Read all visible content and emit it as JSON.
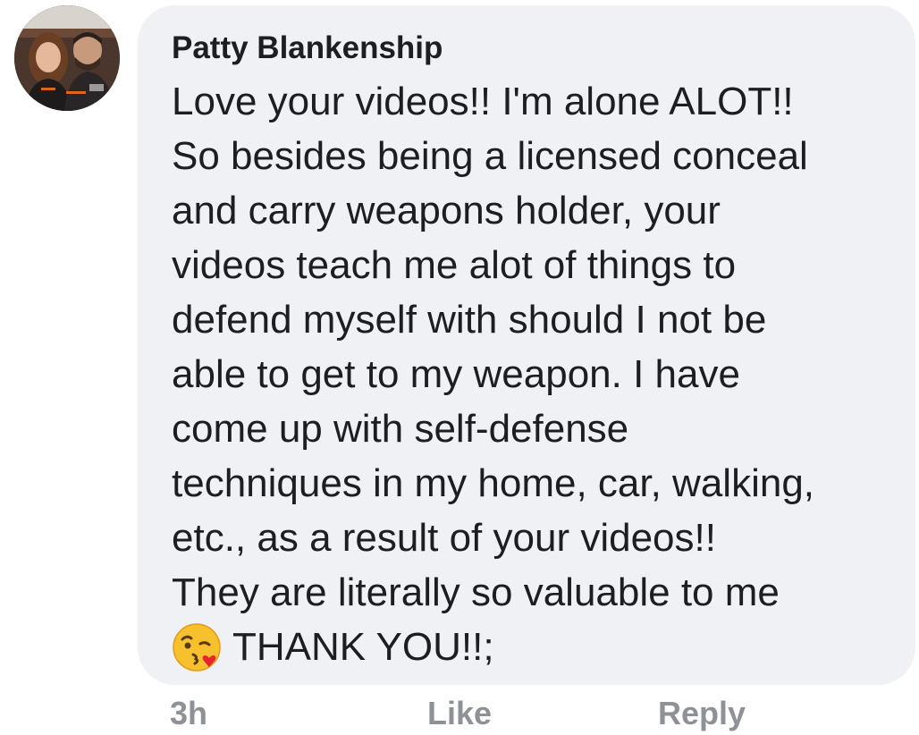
{
  "comment": {
    "author": "Patty Blankenship",
    "lines": [
      "Love your videos!! I'm alone ALOT!!",
      "So besides being a licensed conceal",
      "and carry weapons holder, your",
      "videos teach me alot of things to",
      "defend myself with should I not be",
      "able to get to my weapon. I have",
      "come up with self-defense",
      "techniques in my home, car, walking,",
      "etc.,  as a result of your videos!!",
      "They are literally so valuable to me"
    ],
    "last_line_text": "THANK YOU!!;",
    "emoji": "face-blowing-a-kiss-icon"
  },
  "actions": {
    "time": "3h",
    "like": "Like",
    "reply": "Reply"
  },
  "colors": {
    "bubble": "#eff1f4",
    "text": "#1c1e21",
    "action_text": "#8e9297"
  }
}
